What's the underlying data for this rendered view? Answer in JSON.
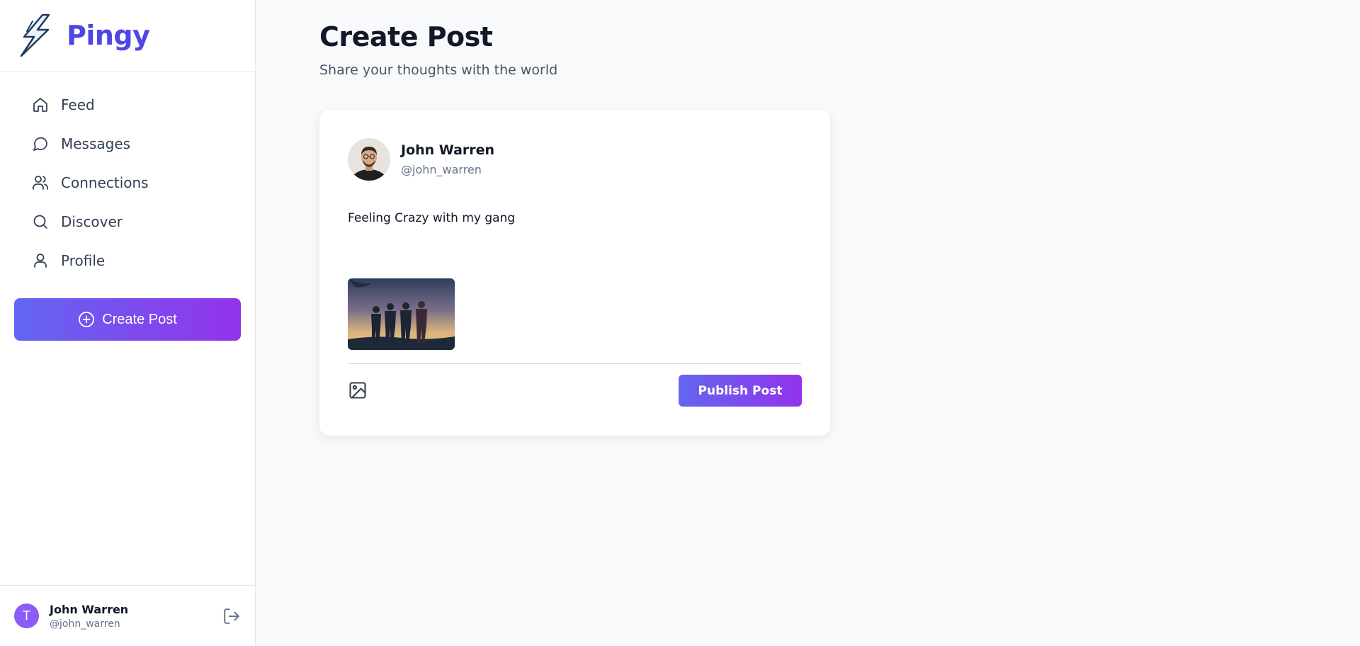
{
  "brand": {
    "name": "Pingy",
    "logo_icon": "lightning-bolt-icon",
    "color": "#4f46e5"
  },
  "sidebar": {
    "items": [
      {
        "label": "Feed",
        "icon": "home-icon"
      },
      {
        "label": "Messages",
        "icon": "message-circle-icon"
      },
      {
        "label": "Connections",
        "icon": "users-icon"
      },
      {
        "label": "Discover",
        "icon": "search-icon"
      },
      {
        "label": "Profile",
        "icon": "user-icon"
      }
    ],
    "create_button": {
      "label": "Create Post",
      "icon": "plus-circle-icon"
    },
    "user": {
      "initial": "T",
      "name": "John Warren",
      "handle": "@john_warren",
      "logout_icon": "logout-icon"
    }
  },
  "main": {
    "title": "Create Post",
    "subtitle": "Share your thoughts with the world",
    "card": {
      "author": {
        "name": "John Warren",
        "handle": "@john_warren"
      },
      "text": "Feeling Crazy with my gang",
      "image_icon": "image-icon",
      "publish_label": "Publish Post"
    }
  },
  "colors": {
    "accent_start": "#6366f1",
    "accent_end": "#9333ea",
    "avatar_bg": "#8b5cf6"
  }
}
